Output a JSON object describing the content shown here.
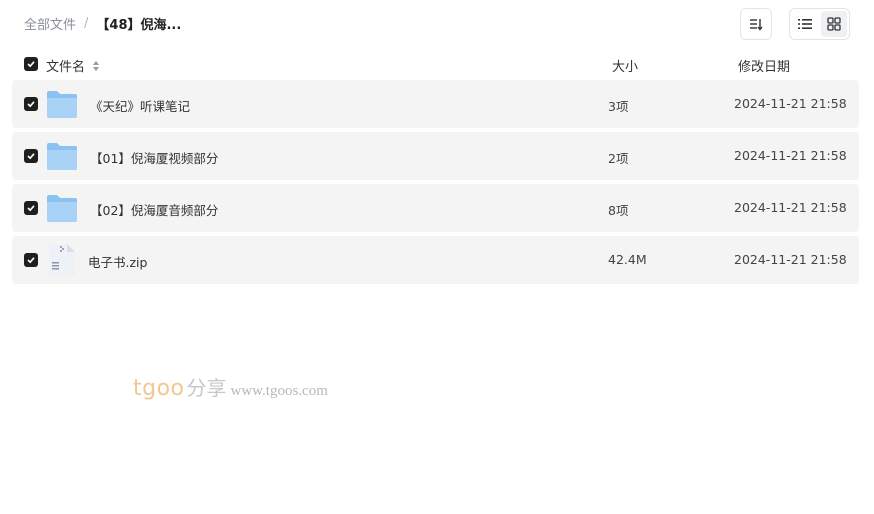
{
  "breadcrumb": {
    "root": "全部文件",
    "separator": "/",
    "current": "【48】倪海..."
  },
  "toolbar": {
    "sort_icon": "sort-icon",
    "list_view_icon": "list-view-icon",
    "grid_view_icon": "grid-view-icon",
    "active_view": "grid"
  },
  "columns": {
    "name": "文件名",
    "size": "大小",
    "date": "修改日期"
  },
  "files": [
    {
      "name": "《天纪》听课笔记",
      "size": "3项",
      "date": "2024-11-21 21:58",
      "type": "folder",
      "checked": true
    },
    {
      "name": "【01】倪海厦视频部分",
      "size": "2项",
      "date": "2024-11-21 21:58",
      "type": "folder",
      "checked": true
    },
    {
      "name": "【02】倪海厦音频部分",
      "size": "8项",
      "date": "2024-11-21 21:58",
      "type": "folder",
      "checked": true
    },
    {
      "name": "电子书.zip",
      "size": "42.4M",
      "date": "2024-11-21 21:58",
      "type": "zip",
      "checked": true
    }
  ],
  "watermark": {
    "brand": "tgoo",
    "share": "分享",
    "url": "www.tgoos.com"
  },
  "colors": {
    "checkbox": "#1f1f1f",
    "row_bg": "#f4f4f5",
    "folder": "#7fb8f0",
    "watermark_brand": "#f2c790"
  }
}
